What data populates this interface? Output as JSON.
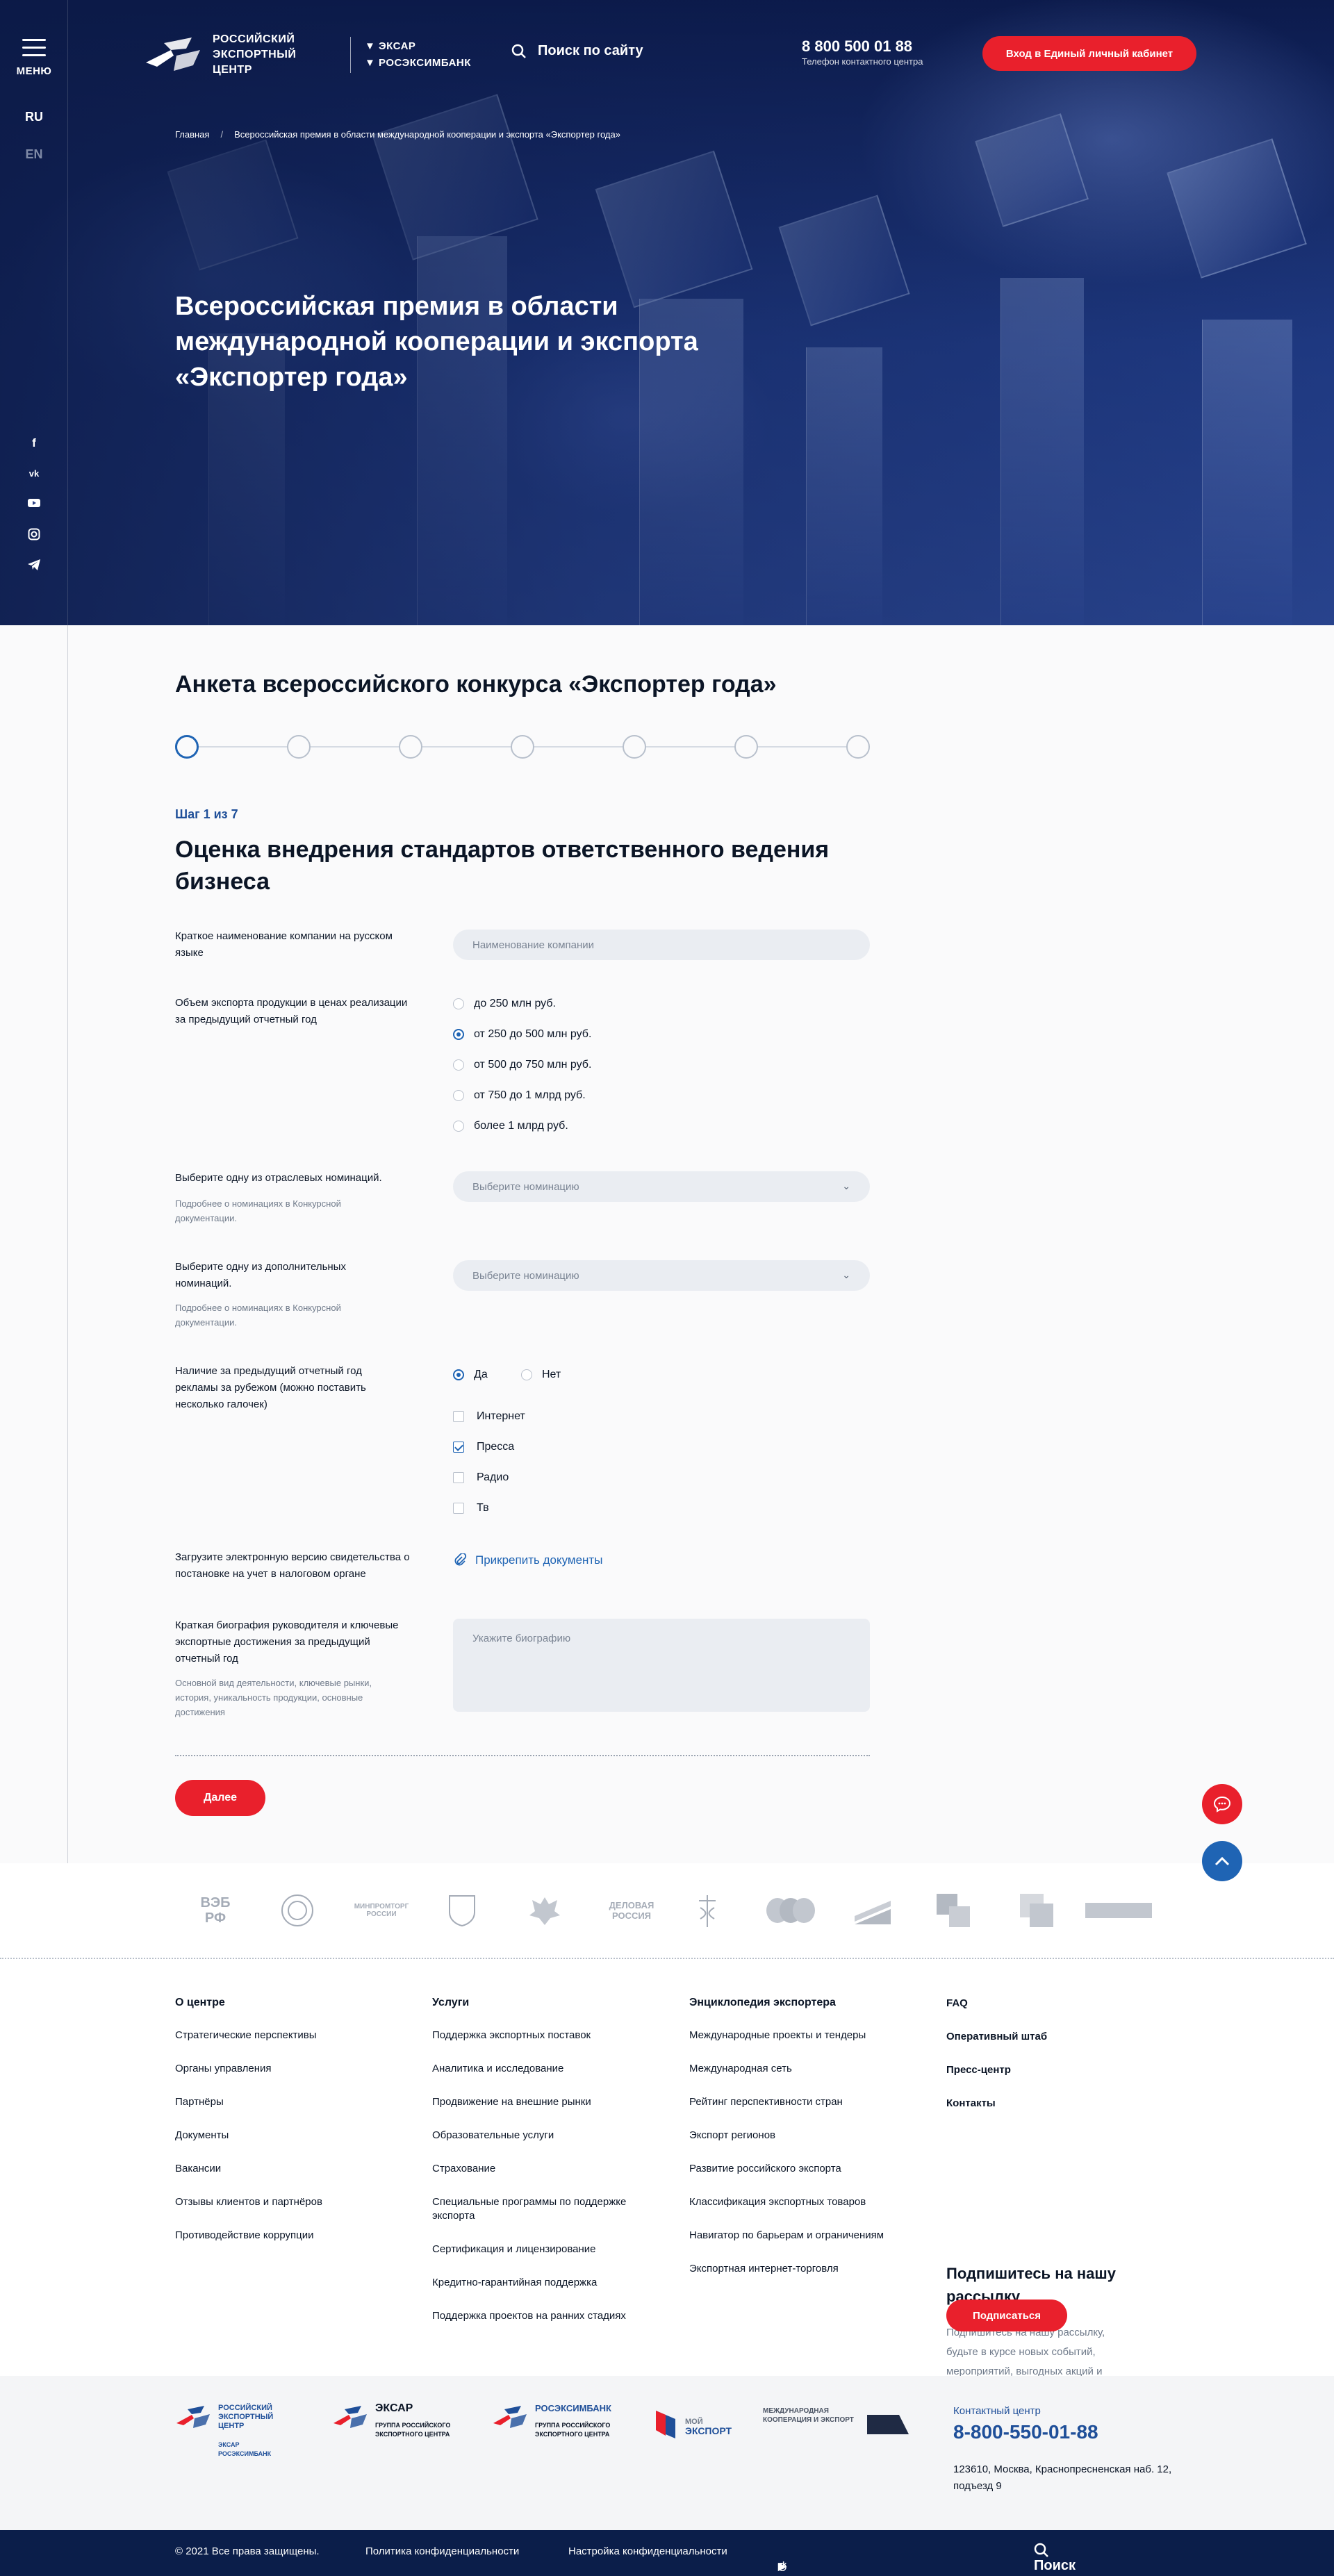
{
  "sidebar": {
    "menu_label": "МЕНЮ",
    "lang_ru": "RU",
    "lang_en": "EN",
    "socials": [
      "f",
      "vk",
      "yt",
      "ig",
      "tg"
    ]
  },
  "header": {
    "logo_line1": "РОССИЙСКИЙ",
    "logo_line2": "ЭКСПОРТНЫЙ ЦЕНТР",
    "logo2_line1": "ЭКСАР",
    "logo2_line2": "РОСЭКСИМБАНК",
    "search_label": "Поиск по сайту",
    "phone": "8 800 500 01 88",
    "phone_caption": "Телефон контактного центра",
    "cabinet_button": "Вход в Единый личный кабинет"
  },
  "breadcrumbs": {
    "home": "Главная",
    "separator": "/",
    "current": "Всероссийская премия в области международной кооперации и экспорта «Экспортер года»"
  },
  "hero": {
    "title": "Всероссийская премия в области международной кооперации и экспорта «Экспортер года»"
  },
  "form": {
    "title": "Анкета всероссийского конкурса «Экспортер года»",
    "steps_total": 7,
    "current_step": 1,
    "step_label": "Шаг 1 из 7",
    "step_title": "Оценка внедрения стандартов ответственного ведения бизнеса",
    "company_label": "Краткое наименование компании на русском языке",
    "company_placeholder": "Наименование компании",
    "export_label": "Объем экспорта продукции в ценах реализации за предыдущий отчетный год",
    "export_options": [
      "до 250 млн руб.",
      "от 250 до 500 млн руб.",
      "от 500 до 750 млн руб.",
      "от 750 до 1 млрд руб.",
      "более 1 млрд руб."
    ],
    "export_selected": 1,
    "industry_label": "Выберите одну из отраслевых номинаций.",
    "industry_hint": "Подробнее о номинациях в Конкурсной документации.",
    "industry_placeholder": "Выберите номинацию",
    "extra_label": "Выберите одну из дополнительных номинаций.",
    "extra_hint": "Подробнее о номинациях в Конкурсной документации.",
    "extra_placeholder": "Выберите номинацию",
    "ads_label": "Наличие за предыдущий отчетный год рекламы за рубежом (можно поставить несколько галочек)",
    "ads_yes": "Да",
    "ads_no": "Нет",
    "ads_channels": [
      "Интернет",
      "Пресса",
      "Радио",
      "Тв"
    ],
    "ads_checked": [
      false,
      true,
      false,
      false
    ],
    "upload_label": "Загрузите электронную версию свидетельства о постановке на учет в налоговом органе",
    "upload_link": "Прикрепить документы",
    "bio_label": "Краткая биография руководителя и ключевые экспортные достижения за предыдущий отчетный год",
    "bio_hint": "Основной вид деятельности, ключевые рынки, история, уникальность продукции, основные достижения",
    "bio_placeholder": "Укажите биографию",
    "next_button": "Далее"
  },
  "partners": [
    "ВЭБ РФ",
    "МИНПРОМТОРГ РОССИИ",
    "ДЕЛОВАЯ РОССИЯ"
  ],
  "footer": {
    "col1_title": "О центре",
    "col1": [
      "Стратегические перспективы",
      "Органы управления",
      "Партнёры",
      "Документы",
      "Вакансии",
      "Отзывы клиентов и партнёров",
      "Противодействие коррупции"
    ],
    "col2_title": "Услуги",
    "col2": [
      "Поддержка экспортных поставок",
      "Аналитика и исследование",
      "Продвижение на внешние рынки",
      "Образовательные услуги",
      "Страхование",
      "Специальные программы по поддержке экспорта",
      "Сертификация и лицензирование",
      "Кредитно-гарантийная поддержка",
      "Поддержка проектов на ранних стадиях"
    ],
    "col3_title": "Энциклопедия экспортера",
    "col3": [
      "Международные проекты и тендеры",
      "Международная сеть",
      "Рейтинг перспективности стран",
      "Экспорт регионов",
      "Развитие российского экспорта",
      "Классификация экспортных товаров",
      "Навигатор по барьерам и ограничениям",
      "Экспортная интернет-торговля"
    ],
    "col4": [
      "FAQ",
      "Оперативный штаб",
      "Пресс-центр",
      "Контакты"
    ],
    "subscribe_title": "Подпишитесь на нашу рассылку",
    "subscribe_text": "Подпишитесь на нашу рассылку, будьте в курсе новых событий, мероприятий, выгодных акций и эксклюзивных предложений",
    "subscribe_button": "Подписаться"
  },
  "bottom_logos": {
    "rec": "РОССИЙСКИЙ ЭКСПОРТНЫЙ ЦЕНТР",
    "rec_sub1": "ЭКСАР",
    "rec_sub2": "РОСЭКСИМБАНК",
    "exiar": "ЭКСАР",
    "exiar_sub": "ГРУППА РОССИЙСКОГО ЭКСПОРТНОГО ЦЕНТРА",
    "eximbank": "РОСЭКСИМБАНК",
    "eximbank_sub": "ГРУППА РОССИЙСКОГО ЭКСПОРТНОГО ЦЕНТРА",
    "myexport_1": "МОЙ",
    "myexport_2": "ЭКСПОРТ",
    "natproj": "МЕЖДУНАРОДНАЯ КООПЕРАЦИЯ И ЭКСПОРТ"
  },
  "contact": {
    "title": "Контактный центр",
    "phone": "8-800-550-01-88",
    "address": "123610, Москва, Краснопресненская наб. 12, подъезд 9"
  },
  "bottombar": {
    "copyright": "© 2021 Все права защищены.",
    "privacy": "Политика конфиденциальности",
    "privacy_settings": "Настройка конфиденциальности",
    "search": "Поиск по сайту"
  },
  "colors": {
    "accent": "#e9202c",
    "brand": "#1f4f99",
    "navy": "#0b1e4a"
  }
}
